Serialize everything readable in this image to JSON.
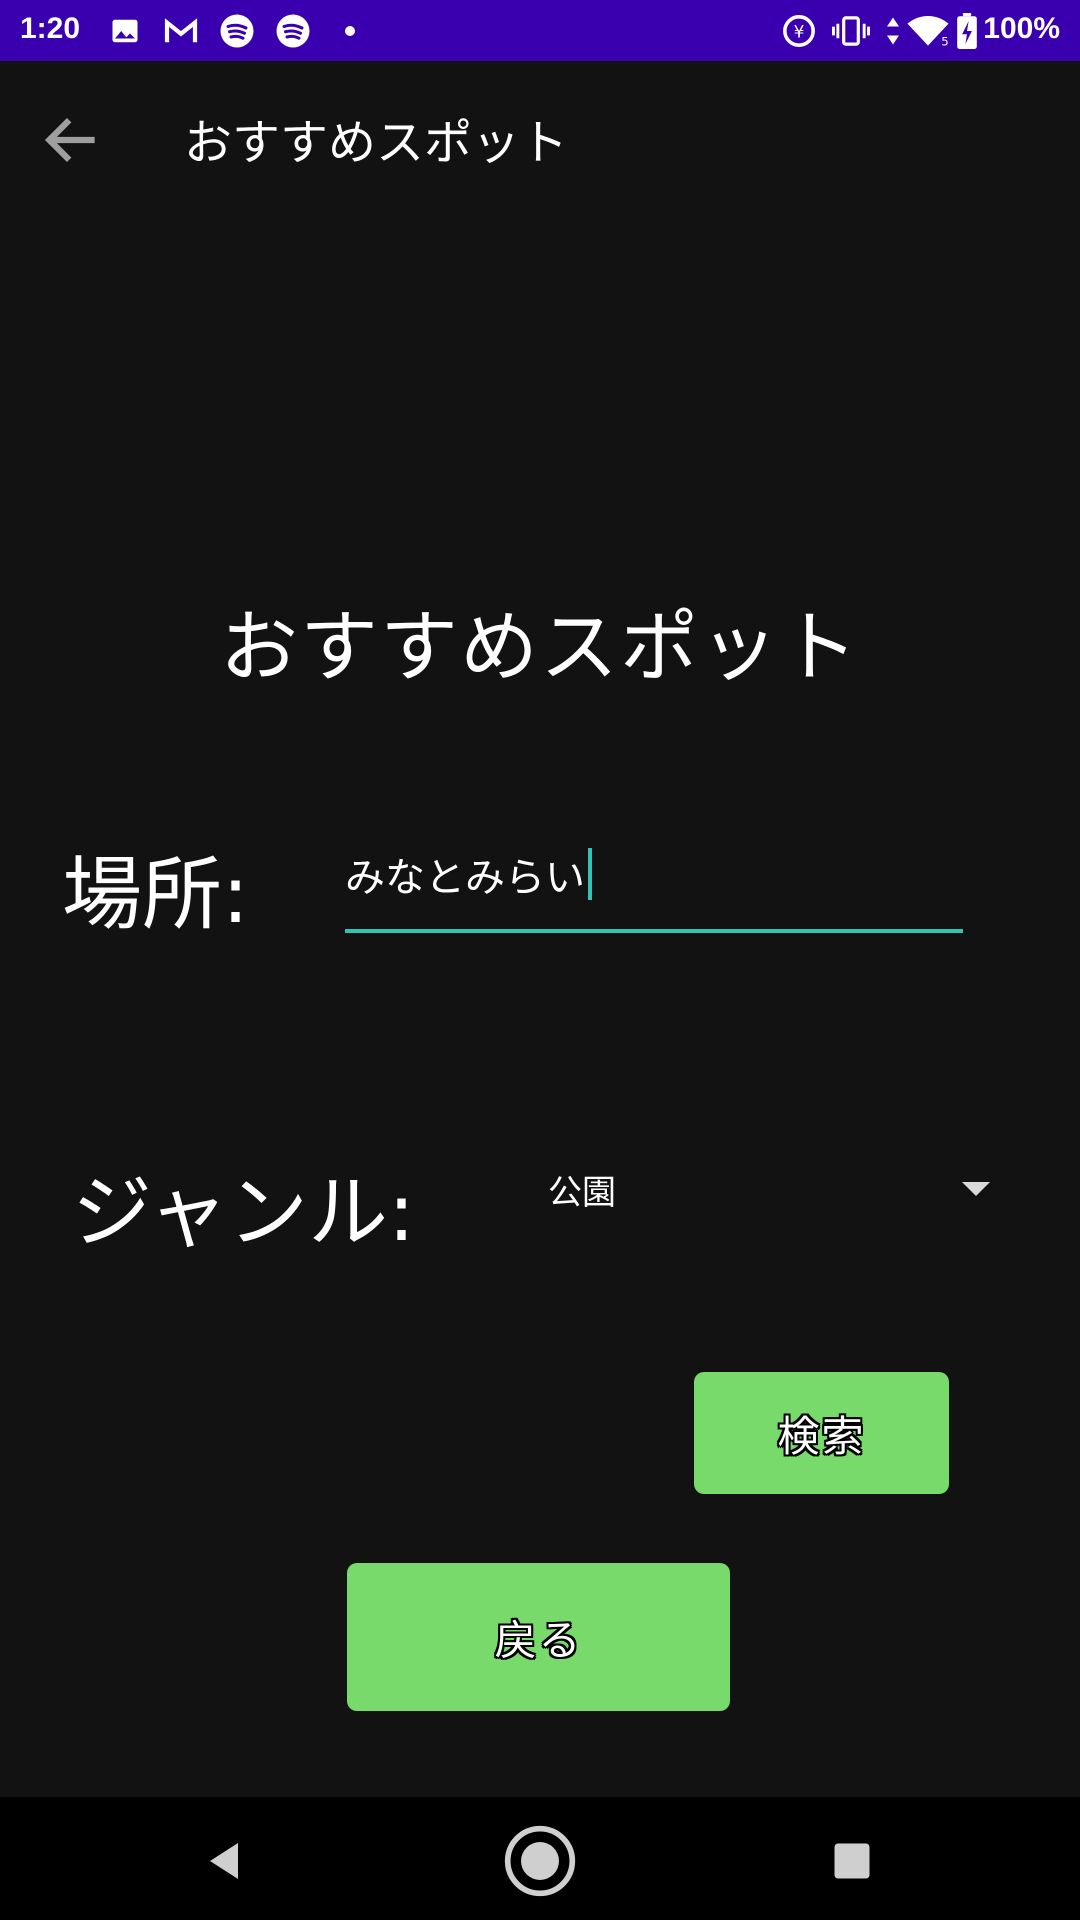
{
  "status_bar": {
    "time": "1:20",
    "battery_text": "100%",
    "network_label": "5",
    "icons": [
      "image-icon",
      "gmail-icon",
      "spotify-icon",
      "spotify-icon",
      "dot-icon",
      "data-saver-icon",
      "vibrate-icon",
      "data-arrows-icon",
      "wifi-icon",
      "battery-charging-icon"
    ]
  },
  "app_bar": {
    "title": "おすすめスポット"
  },
  "main": {
    "heading": "おすすめスポット",
    "place_label": "場所:",
    "place_value": "みなとみらい",
    "genre_label": "ジャンル:",
    "genre_selected": "公園",
    "search_button": "検索",
    "back_button": "戻る"
  },
  "colors": {
    "status_bar": "#3a00b0",
    "background": "#121212",
    "accent": "#2ec4b6",
    "button": "#78da6a"
  }
}
